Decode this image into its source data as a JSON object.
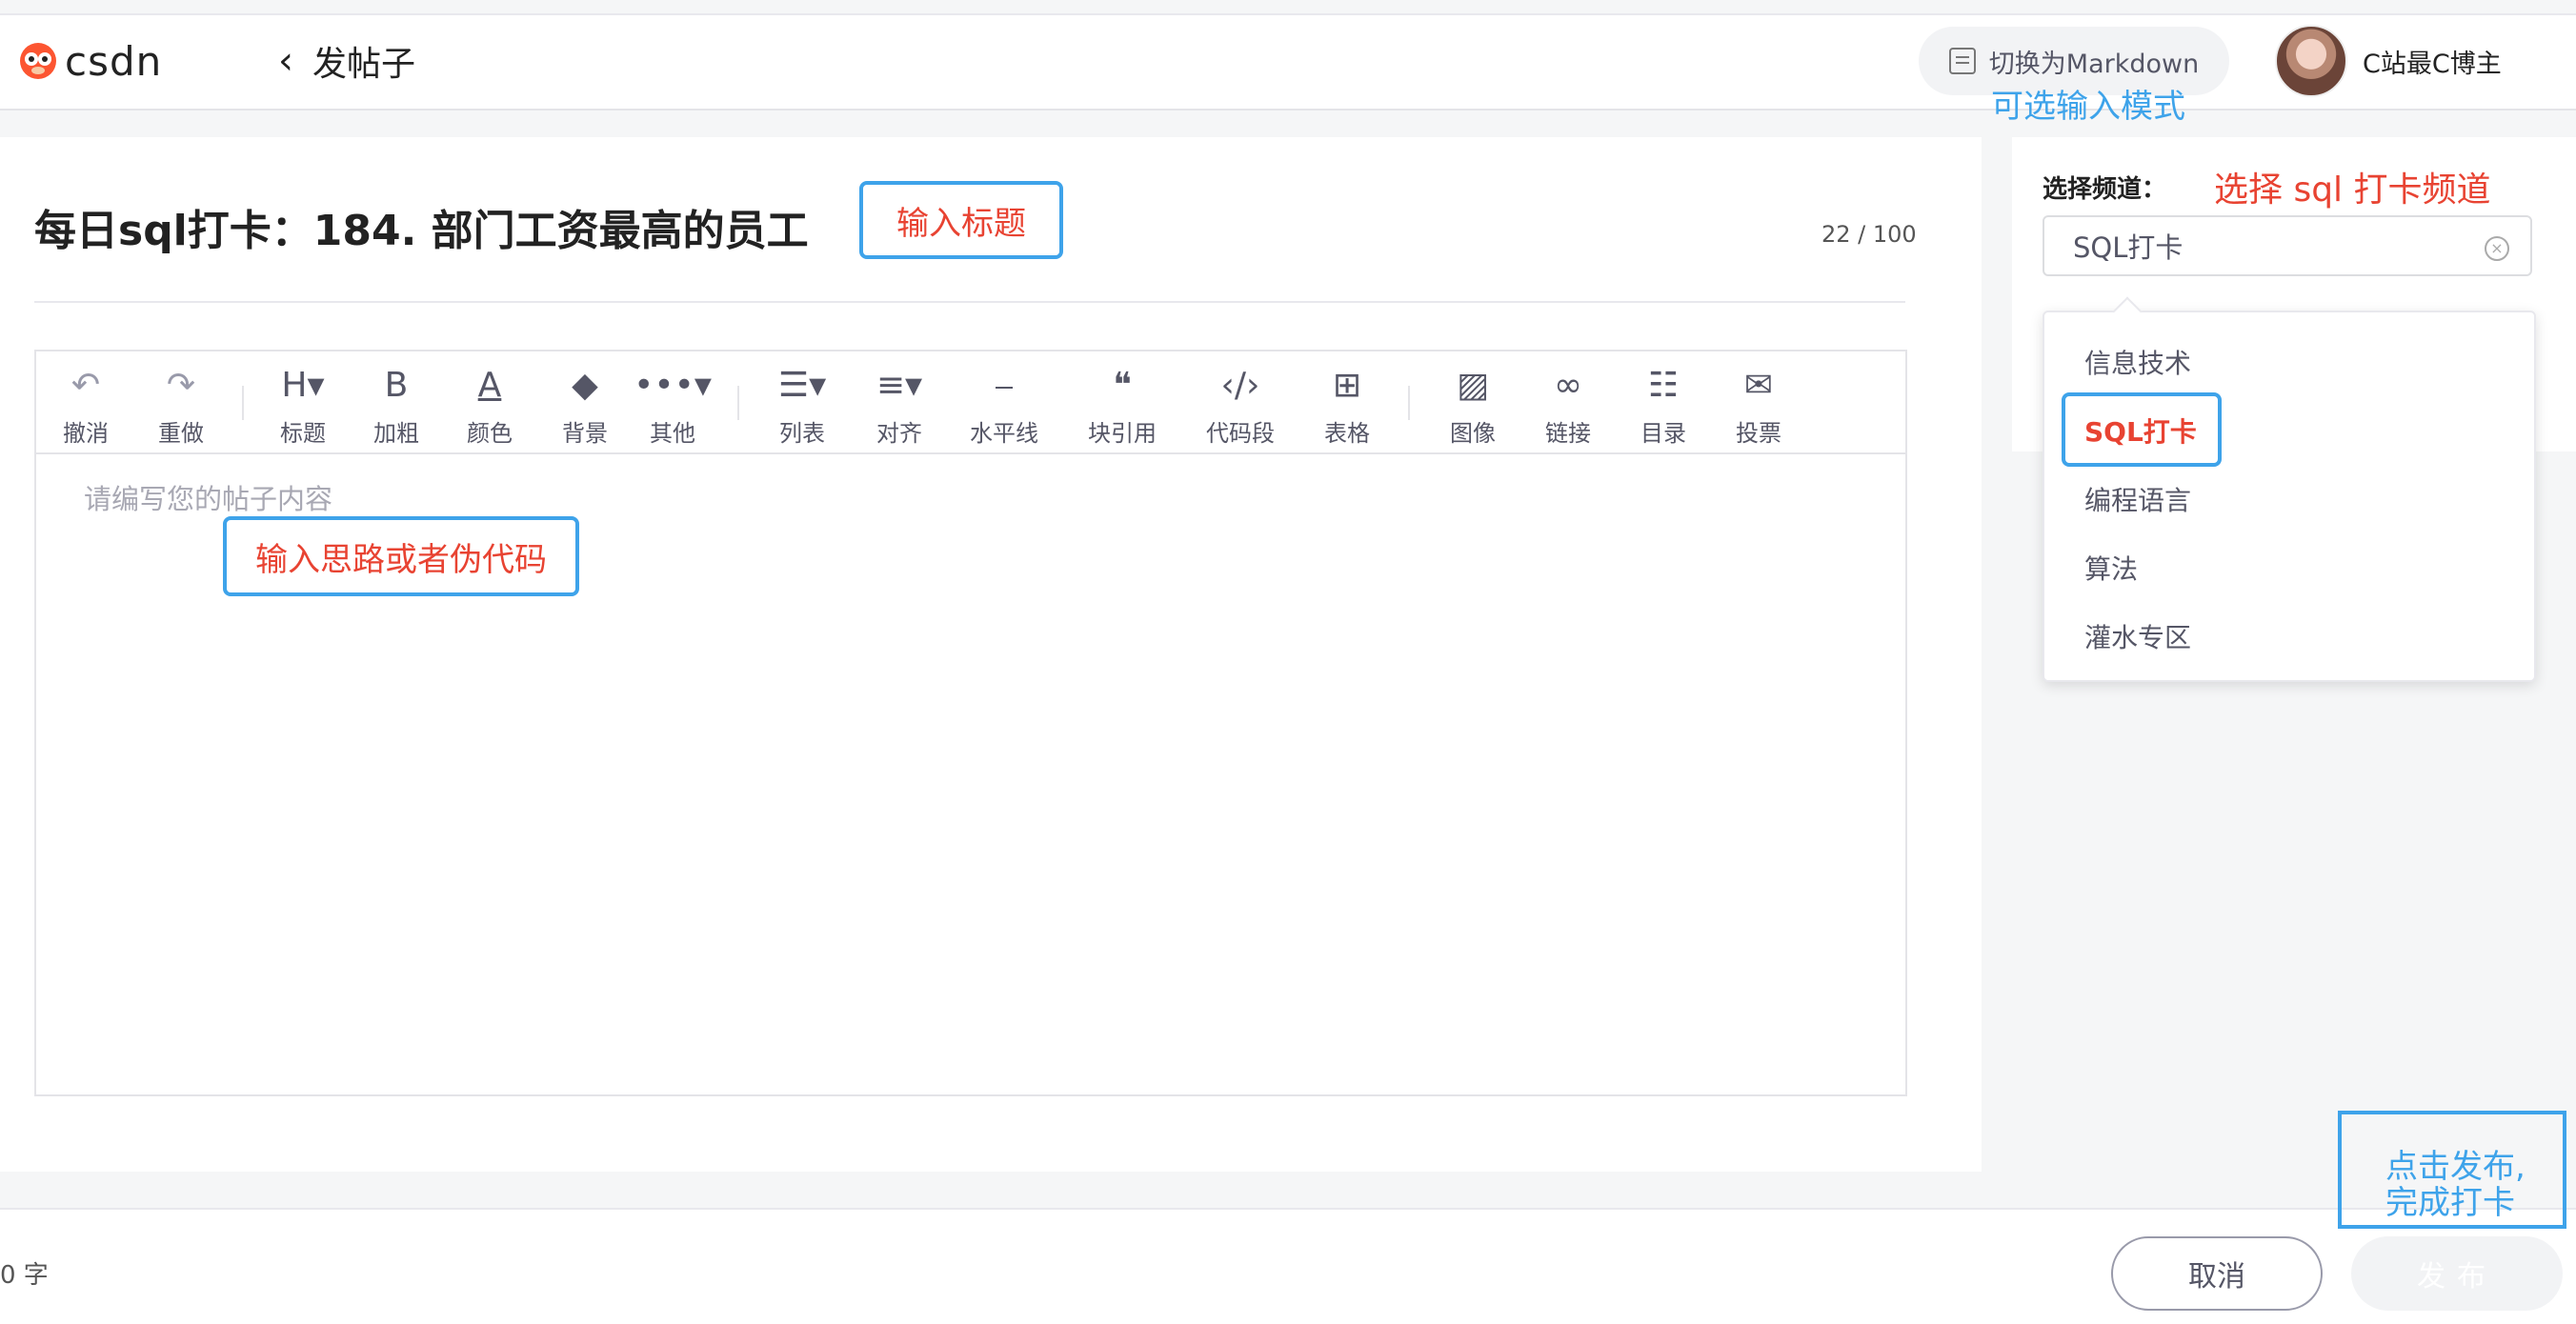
{
  "header": {
    "logo_text": "csdn",
    "back_chevron": "‹",
    "page_title": "发帖子",
    "markdown_switch_label": "切换为Markdown",
    "markdown_hint": "可选输入模式",
    "user_name": "C站最C博主"
  },
  "post": {
    "title": "每日sql打卡：184. 部门工资最高的员工",
    "title_counter": "22 / 100",
    "title_callout": "输入标题",
    "content_placeholder": "请编写您的帖子内容",
    "content_callout": "输入思路或者伪代码"
  },
  "toolbar": [
    {
      "icon": "undo-icon",
      "glyph": "↶",
      "label": "撤消",
      "disabled": true
    },
    {
      "icon": "redo-icon",
      "glyph": "↷",
      "label": "重做",
      "disabled": true
    },
    {
      "icon": "heading-icon",
      "glyph": "H▾",
      "label": "标题"
    },
    {
      "icon": "bold-icon",
      "glyph": "B",
      "label": "加粗"
    },
    {
      "icon": "font-color-icon",
      "glyph": "A",
      "label": "颜色"
    },
    {
      "icon": "paint-bucket-icon",
      "glyph": "◆",
      "label": "背景"
    },
    {
      "icon": "more-icon",
      "glyph": "•••▾",
      "label": "其他"
    },
    {
      "icon": "list-icon",
      "glyph": "☰▾",
      "label": "列表"
    },
    {
      "icon": "align-icon",
      "glyph": "≡▾",
      "label": "对齐"
    },
    {
      "icon": "horizontal-rule-icon",
      "glyph": "⎯",
      "label": "水平线"
    },
    {
      "icon": "quote-icon",
      "glyph": "❝",
      "label": "块引用"
    },
    {
      "icon": "code-icon",
      "glyph": "‹/›",
      "label": "代码段"
    },
    {
      "icon": "table-icon",
      "glyph": "⊞",
      "label": "表格"
    },
    {
      "icon": "image-icon",
      "glyph": "▨",
      "label": "图像"
    },
    {
      "icon": "link-icon",
      "glyph": "∞",
      "label": "链接"
    },
    {
      "icon": "toc-icon",
      "glyph": "☷",
      "label": "目录"
    },
    {
      "icon": "vote-icon",
      "glyph": "✉",
      "label": "投票"
    }
  ],
  "channel": {
    "label": "选择频道：",
    "hint": "选择 sql 打卡频道",
    "selected_value": "SQL打卡",
    "options": [
      {
        "label": "信息技术",
        "selected": false
      },
      {
        "label": "SQL打卡",
        "selected": true
      },
      {
        "label": "编程语言",
        "selected": false
      },
      {
        "label": "算法",
        "selected": false
      },
      {
        "label": "灌水专区",
        "selected": false
      }
    ]
  },
  "footer": {
    "word_count": "0 字",
    "cancel_label": "取消",
    "publish_label": "发布",
    "publish_callout_line1": "点击发布,",
    "publish_callout_line2": "完成打卡"
  },
  "colors": {
    "accent_red": "#e84332",
    "callout_blue": "#3ea3ea",
    "brand_orange": "#fc5531"
  }
}
